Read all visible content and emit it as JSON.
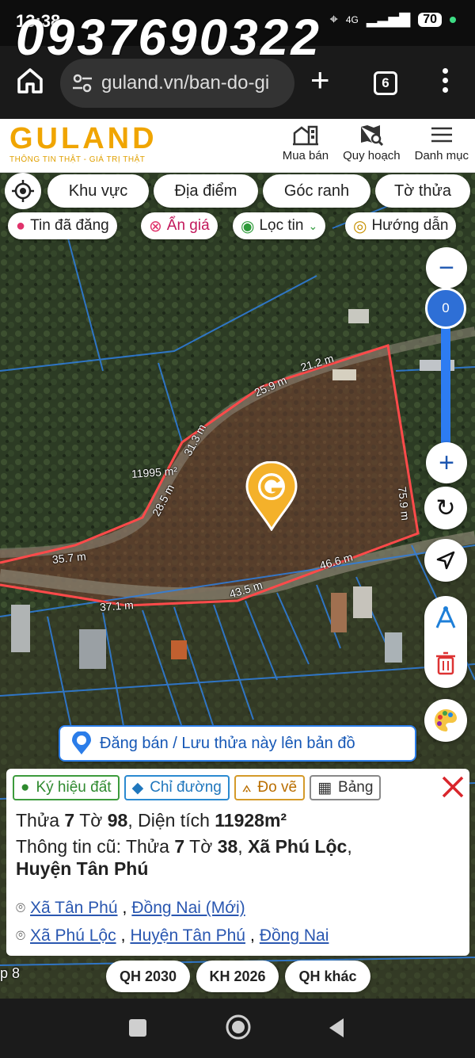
{
  "status": {
    "time": "13:38",
    "network": "4G",
    "battery": "70"
  },
  "watermark": "0937690322",
  "browser": {
    "url": "guland.vn/ban-do-gi",
    "tab_count": "6"
  },
  "site": {
    "logo": "GULAND",
    "tagline": "THÔNG TIN THẬT - GIÁ TRỊ THẬT",
    "nav": [
      "Mua bán",
      "Quy hoạch",
      "Danh mục"
    ]
  },
  "filters": [
    "Khu vực",
    "Địa điểm",
    "Góc ranh",
    "Tờ thửa"
  ],
  "chips": [
    "Tin đã đăng",
    "Ẩn giá",
    "Lọc tin",
    "Hướng dẫn"
  ],
  "zoom_level": "0",
  "map_labels": {
    "area": "11995 m²",
    "edges": [
      "21.2 m",
      "25.9 m",
      "31.3 m",
      "28.5 m",
      "75.9 m",
      "35.7 m",
      "46.6 m",
      "43.5 m",
      "37.1 m"
    ],
    "road": "p 8"
  },
  "post_banner": "Đăng bán / Lưu thửa này lên bản đồ",
  "panel": {
    "tabs": [
      "Ký hiệu đất",
      "Chỉ đường",
      "Đo vẽ",
      "Bảng"
    ],
    "line1": {
      "thua_label": "Thửa",
      "thua": "7",
      "to_label": "Tờ",
      "to": "98",
      "area_label": ", Diện tích",
      "area": "11928m²"
    },
    "line2": {
      "prefix": "Thông tin cũ: Thửa",
      "thua": "7",
      "to_label": "Tờ",
      "to": "38",
      "xa": "Xã Phú Lộc",
      "huyen": "Huyện Tân Phú"
    },
    "loc1": [
      "Xã Tân Phú",
      "Đồng Nai (Mới)"
    ],
    "loc2": [
      "Xã Phú Lộc",
      "Huyện Tân Phú",
      "Đồng Nai"
    ]
  },
  "bottom_buttons": [
    "QH 2030",
    "KH 2026",
    "QH khác"
  ],
  "colors": {
    "brand": "#f0a500",
    "boundary": "#ff4a4a",
    "accent_blue": "#2b7de9"
  }
}
